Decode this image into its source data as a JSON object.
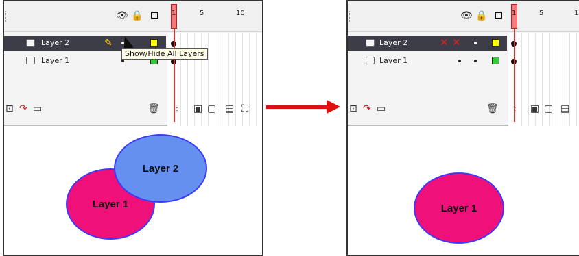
{
  "colors": {
    "selected_row": "#3d3d48",
    "playhead": "#e03030",
    "layer1_fill": "#f0107a",
    "layer2_fill": "#6690f0",
    "ellipse_stroke": "#3a3aff",
    "arrow": "#e01010",
    "layer2_swatch": "#ffff00",
    "layer1_swatch": "#33cc33"
  },
  "header_icons": [
    "eye-icon",
    "lock-icon",
    "outline-icon"
  ],
  "frame_numbers": [
    "1",
    "5",
    "10"
  ],
  "before": {
    "layers": [
      {
        "name": "Layer 2",
        "selected": true,
        "status": "pencil-icon"
      },
      {
        "name": "Layer 1",
        "selected": false
      }
    ],
    "tooltip": "Show/Hide All Layers",
    "stage_shapes": [
      {
        "label": "Layer 1"
      },
      {
        "label": "Layer 2"
      }
    ]
  },
  "after": {
    "layers": [
      {
        "name": "Layer 2",
        "selected": true,
        "status": "hidden-x-icon"
      },
      {
        "name": "Layer 1",
        "selected": false
      }
    ],
    "stage_shapes": [
      {
        "label": "Layer 1"
      }
    ]
  },
  "bottom_icons": [
    "new-layer-icon",
    "motion-guide-icon",
    "new-folder-icon",
    "trash-icon"
  ]
}
